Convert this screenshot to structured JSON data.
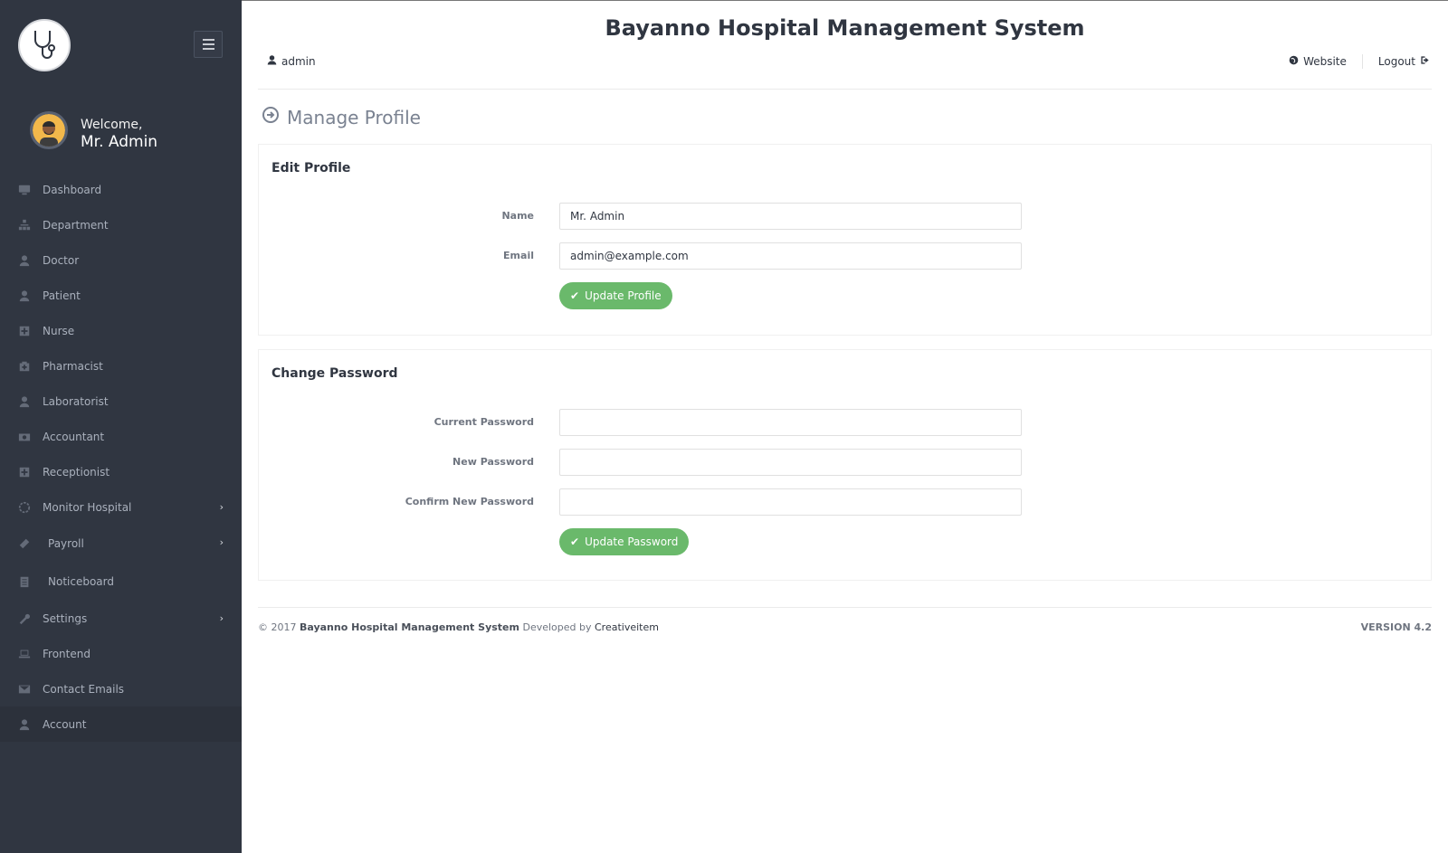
{
  "app": {
    "title": "Bayanno Hospital Management System"
  },
  "header": {
    "user_label": "admin",
    "website_label": "Website",
    "logout_label": "Logout"
  },
  "sidebar": {
    "welcome": "Welcome,",
    "user_name": "Mr. Admin",
    "items": [
      {
        "label": "Dashboard",
        "icon": "monitor-icon"
      },
      {
        "label": "Department",
        "icon": "sitemap-icon"
      },
      {
        "label": "Doctor",
        "icon": "user-md-icon"
      },
      {
        "label": "Patient",
        "icon": "user-icon"
      },
      {
        "label": "Nurse",
        "icon": "plus-square-icon"
      },
      {
        "label": "Pharmacist",
        "icon": "medkit-icon"
      },
      {
        "label": "Laboratorist",
        "icon": "user-icon"
      },
      {
        "label": "Accountant",
        "icon": "money-icon"
      },
      {
        "label": "Receptionist",
        "icon": "plus-square-icon"
      },
      {
        "label": "Monitor Hospital",
        "icon": "gear-icon",
        "has_submenu": true
      },
      {
        "label": "Payroll",
        "icon": "wallet-icon",
        "has_submenu": true
      },
      {
        "label": "Noticeboard",
        "icon": "clipboard-icon"
      },
      {
        "label": "Settings",
        "icon": "wrench-icon",
        "has_submenu": true
      },
      {
        "label": "Frontend",
        "icon": "laptop-icon"
      },
      {
        "label": "Contact Emails",
        "icon": "envelope-icon"
      },
      {
        "label": "Account",
        "icon": "user-icon",
        "active": true
      }
    ]
  },
  "main": {
    "page_title": "Manage Profile",
    "edit_profile": {
      "heading": "Edit Profile",
      "name_label": "Name",
      "name_value": "Mr. Admin",
      "email_label": "Email",
      "email_value": "admin@example.com",
      "button": "Update Profile"
    },
    "change_password": {
      "heading": "Change Password",
      "current_label": "Current Password",
      "new_label": "New Password",
      "confirm_label": "Confirm New Password",
      "button": "Update Password"
    }
  },
  "footer": {
    "copyright": "© 2017",
    "system_name": "Bayanno Hospital Management System",
    "developed_by": "Developed by",
    "developer": "Creativeitem",
    "version": "VERSION 4.2"
  },
  "colors": {
    "sidebar_bg": "#303641",
    "accent_green": "#6ab96b",
    "text_dark": "#303641"
  }
}
